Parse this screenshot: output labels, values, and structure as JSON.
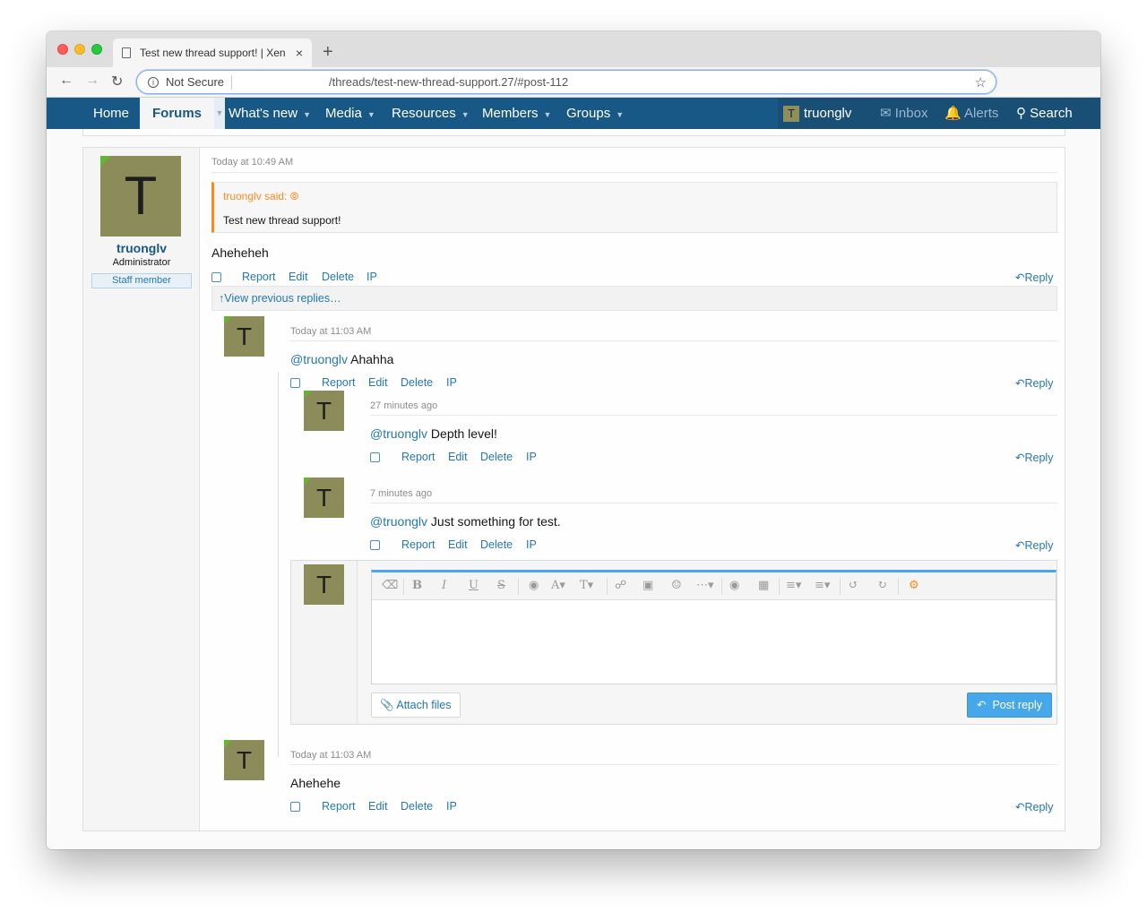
{
  "browser": {
    "tab_title": "Test new thread support! | Xen",
    "security_label": "Not Secure",
    "url": "/threads/test-new-thread-support.27/#post-112",
    "new_tab": "+",
    "close": "×"
  },
  "nav": {
    "tabs": [
      {
        "label": "Home"
      },
      {
        "label": "Forums"
      },
      {
        "label": "What's new"
      },
      {
        "label": "Media"
      },
      {
        "label": "Resources"
      },
      {
        "label": "Members"
      },
      {
        "label": "Groups"
      }
    ],
    "user_initial": "T",
    "username": "truonglv",
    "inbox": "Inbox",
    "alerts": "Alerts",
    "search": "Search"
  },
  "author": {
    "initial": "T",
    "name": "truonglv",
    "title": "Administrator",
    "badge": "Staff member"
  },
  "post": {
    "date": "Today at 10:49 AM",
    "quote_author": "truonglv said:",
    "quote_text": "Test new thread support!",
    "body": "Aheheheh"
  },
  "actions": {
    "report": "Report",
    "edit": "Edit",
    "delete": "Delete",
    "ip": "IP",
    "reply": "Reply"
  },
  "view_previous": "View previous replies…",
  "replies": [
    {
      "initial": "T",
      "date": "Today at 11:03 AM",
      "mention": "@truonglv",
      "text": " Ahahha"
    },
    {
      "initial": "T",
      "date": "27 minutes ago",
      "mention": "@truonglv",
      "text": " Depth level!"
    },
    {
      "initial": "T",
      "date": "7 minutes ago",
      "mention": "@truonglv",
      "text": " Just something for test."
    },
    {
      "initial": "T",
      "date": "Today at 11:03 AM",
      "mention": "",
      "text": "Ahehehe"
    }
  ],
  "editor": {
    "initial": "T",
    "attach": "Attach files",
    "post_reply": "Post reply"
  }
}
